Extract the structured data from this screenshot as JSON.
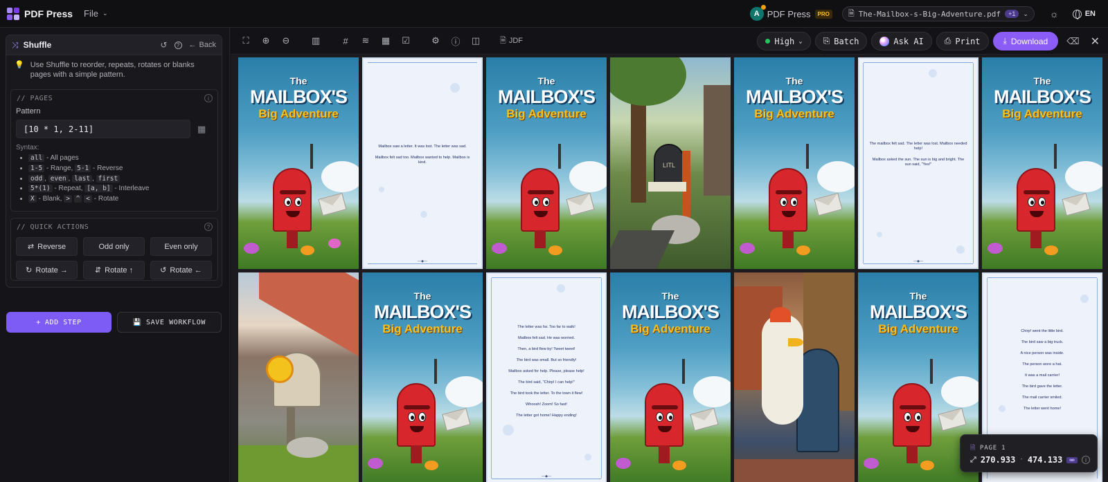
{
  "app": {
    "name": "PDF Press",
    "file_menu": "File",
    "brand_label": "PDF Press",
    "avatar_letter": "A",
    "pro_badge": "PRO"
  },
  "file": {
    "name": "The-Mailbox-s-Big-Adventure.pdf",
    "extra_count": "+1"
  },
  "language": "EN",
  "tool": {
    "title": "Shuffle",
    "back_label": "Back",
    "tip": "Use Shuffle to reorder, repeats, rotates or blanks pages with a simple pattern.",
    "pages_header": "// PAGES",
    "pattern_label": "Pattern",
    "pattern_value": "[10 * 1, 2-11]",
    "syntax_label": "Syntax:",
    "syntax": [
      {
        "codes": [
          "all"
        ],
        "desc": " - All pages"
      },
      {
        "codes": [
          "1-5"
        ],
        "mid": " - Range, ",
        "codes2": [
          "5-1"
        ],
        "desc": " - Reverse"
      },
      {
        "codes": [
          "odd",
          "even",
          "last",
          "first"
        ],
        "desc": ""
      },
      {
        "codes": [
          "5*(1)"
        ],
        "mid": " - Repeat, ",
        "codes2": [
          "[a, b]"
        ],
        "desc": " - Interleave"
      },
      {
        "codes": [
          "X"
        ],
        "mid": " - Blank, ",
        "codes2": [
          ">",
          "^",
          "<"
        ],
        "desc": " - Rotate"
      }
    ],
    "quick_header": "// QUICK ACTIONS",
    "quick_actions": [
      "Reverse",
      "Odd only",
      "Even only",
      "Rotate →",
      "Rotate ↑",
      "Rotate ←"
    ],
    "add_step": "ADD STEP",
    "save_workflow": "SAVE WORKFLOW"
  },
  "toolbar": {
    "jdf": "JDF",
    "quality": "High",
    "batch": "Batch",
    "ask_ai": "Ask AI",
    "print": "Print",
    "download": "Download"
  },
  "pages": {
    "cover": {
      "line1": "The",
      "line2": "MAILBOX'S",
      "line3": "Big Adventure"
    },
    "tree_sign": "LITL",
    "text_a": [
      "Mailbox saw a letter.  It was lost.  The letter was sad.",
      "Mailbox felt sad too.  Mailbox wanted to help.  Mailbox is kind."
    ],
    "text_b": [
      "The mailbox felt sad.  The letter was lost.  Mailbox needed help!",
      "Mailbox asked the sun.  The sun is big and bright.  The sun said, \"Yes!\""
    ],
    "text_c": [
      "The letter was far.  Too far to walk!",
      "Mailbox felt sad.  He was worried.",
      "Then, a bird flew by!  Tweet tweet!",
      "The bird was small.  But so friendly!",
      "Mailbox asked for help.  Please, please help!",
      "The bird said, \"Chirp! I can help!\"",
      "The bird took the letter.  To the town it flew!",
      "Whoosh! Zoom!  So fast!",
      "The letter got home!  Happy ending!"
    ],
    "text_d": [
      "Chirp! went the little bird.",
      "The bird saw a big truck.",
      "A nice person was inside.",
      "The person wore a hat.",
      "It was a mail carrier!",
      "The bird gave the letter.",
      "The mail carrier smiled.",
      "The letter went home!"
    ]
  },
  "info": {
    "page_label": "PAGE 1",
    "width": "270.933",
    "height": "474.133",
    "unit": "mm"
  }
}
